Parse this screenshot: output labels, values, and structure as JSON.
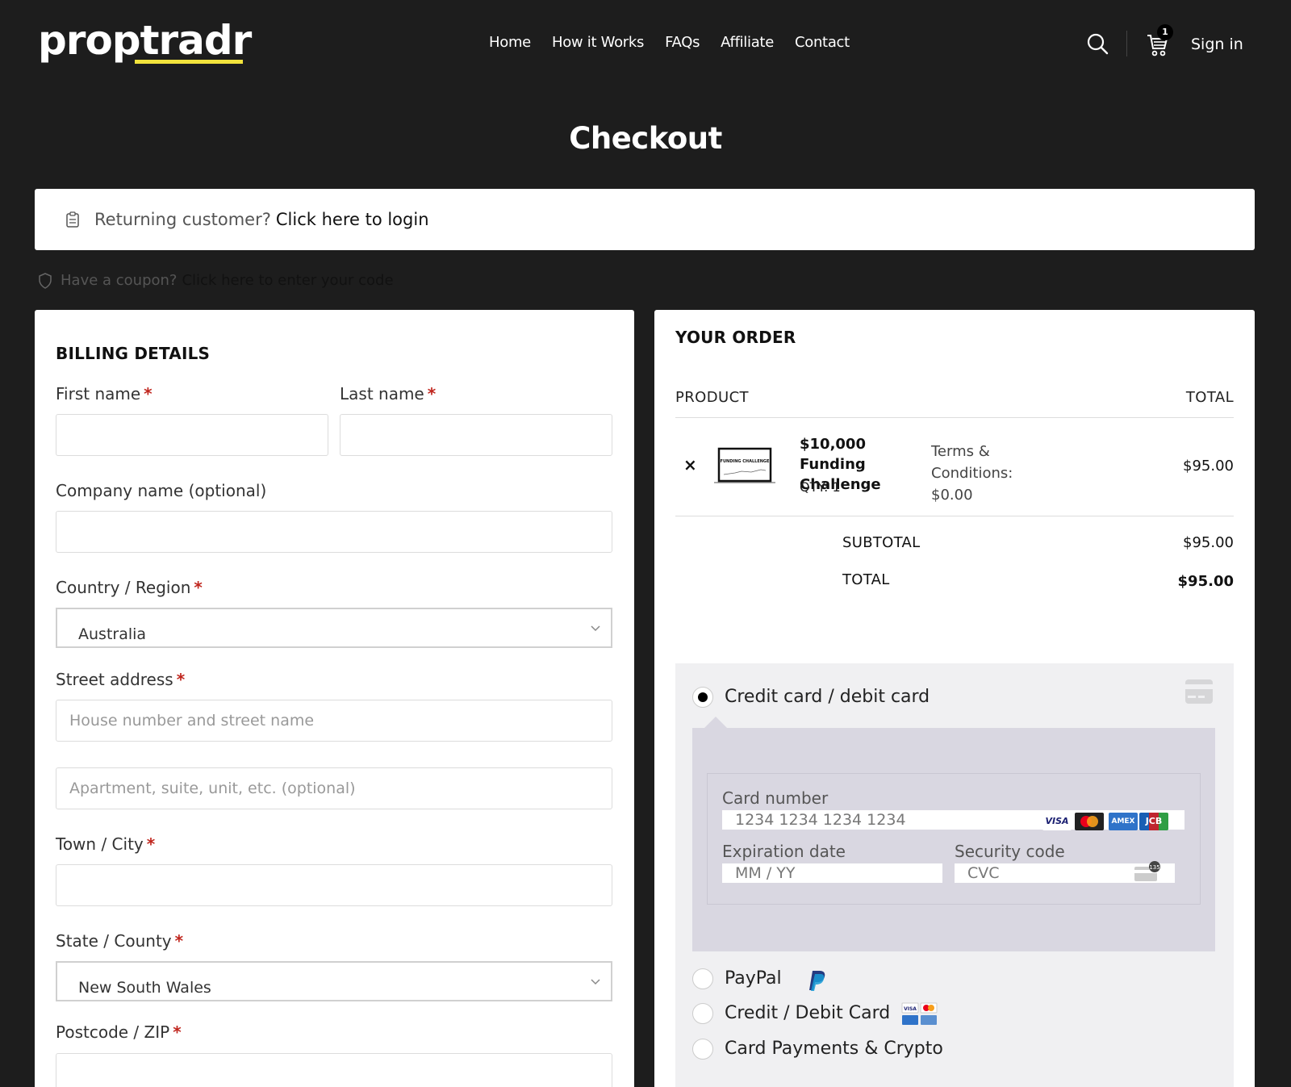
{
  "header": {
    "logo": "proptradr",
    "nav": [
      "Home",
      "How it Works",
      "FAQs",
      "Affiliate",
      "Contact"
    ],
    "cart_count": "1",
    "signin": "Sign in"
  },
  "page_title": "Checkout",
  "returning": {
    "question": "Returning customer?",
    "link": "Click here to login"
  },
  "coupon": {
    "question": "Have a coupon?",
    "link": "Click here to enter your code"
  },
  "billing": {
    "title": "BILLING DETAILS",
    "first_name": "First name",
    "last_name": "Last name",
    "company": "Company name (optional)",
    "country_label": "Country / Region",
    "country_value": "Australia",
    "street_label": "Street address",
    "street_placeholder": "House number and street name",
    "apt_placeholder": "Apartment, suite, unit, etc. (optional)",
    "city_label": "Town / City",
    "state_label": "State / County",
    "state_value": "New South Wales",
    "postcode_label": "Postcode / ZIP",
    "required_mark": "*"
  },
  "order": {
    "title": "YOUR ORDER",
    "col_product": "PRODUCT",
    "col_total": "TOTAL",
    "remove": "×",
    "product_name": "$10,000 Funding Challenge",
    "qty": "QTY:  1",
    "terms": "Terms & Conditions: $0.00",
    "product_price": "$95.00",
    "subtotal_label": "SUBTOTAL",
    "subtotal_value": "$95.00",
    "total_label": "TOTAL",
    "total_value": "$95.00",
    "thumb_text": "FUNDING CHALLENGE"
  },
  "payment": {
    "card_method": "Credit card / debit card",
    "card_number_label": "Card number",
    "card_number_placeholder": "1234 1234 1234 1234",
    "expiry_label": "Expiration date",
    "expiry_placeholder": "MM / YY",
    "cvc_label": "Security code",
    "cvc_placeholder": "CVC",
    "brands": [
      "VISA",
      "MC",
      "AMEX",
      "JCB"
    ],
    "methods": [
      "PayPal",
      "Credit / Debit Card",
      "Card Payments & Crypto"
    ]
  }
}
